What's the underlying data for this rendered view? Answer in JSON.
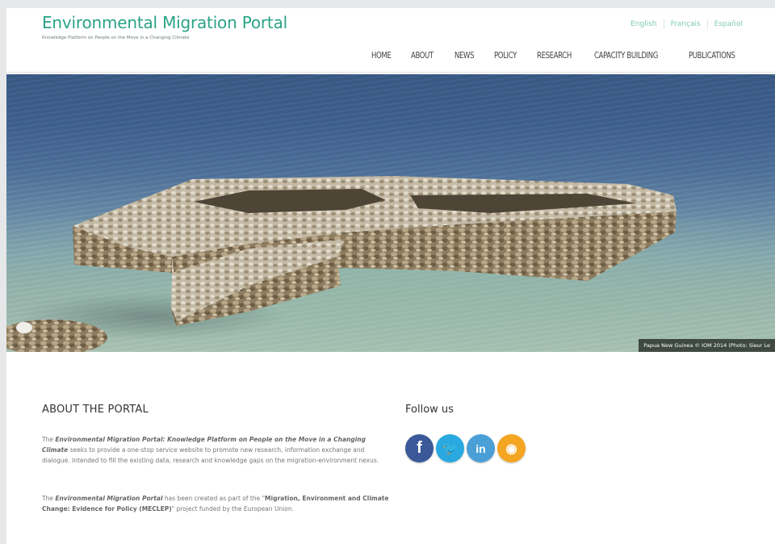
{
  "header": {
    "title": "Environmental Migration Portal",
    "tagline": "Knowledge Platform on People on the Move in a Changing Climate",
    "languages": [
      "English",
      "Français",
      "Español"
    ],
    "nav": [
      "HOME",
      "ABOUT",
      "NEWS",
      "POLICY",
      "RESEARCH",
      "CAPACITY BUILDING",
      "PUBLICATIONS"
    ]
  },
  "hero": {
    "caption": "Papua New Guinea © IOM 2014 (Photo: Sieur Le"
  },
  "about": {
    "title": "ABOUT THE PORTAL",
    "p1_lead": "The",
    "p1_em": "Environmental Migration Portal: Knowledge Platform on People on the Move in a Changing Climate",
    "p1_rest": "seeks to provide a one-stop service website to promote new research, information exchange and dialogue. Intended to fill the existing data, research and knowledge gaps on the migration-environment nexus.",
    "p2_lead": "The",
    "p2_em": "Environmental Migration Portal",
    "p2_mid": "has been created as part of the \"",
    "p2_bold": "Migration, Environment and Climate Change: Evidence for Policy (MECLEP)",
    "p2_rest": "\" project funded by the European Union."
  },
  "follow": {
    "title": "Follow us",
    "icons": [
      {
        "name": "facebook-icon",
        "glyph": "f",
        "color": "#3b5998"
      },
      {
        "name": "twitter-icon",
        "glyph": "🐦",
        "color": "#2aa9e0"
      },
      {
        "name": "linkedin-icon",
        "glyph": "in",
        "color": "#4a9fd6"
      },
      {
        "name": "rss-icon",
        "glyph": "◉",
        "color": "#f4a521"
      }
    ]
  }
}
